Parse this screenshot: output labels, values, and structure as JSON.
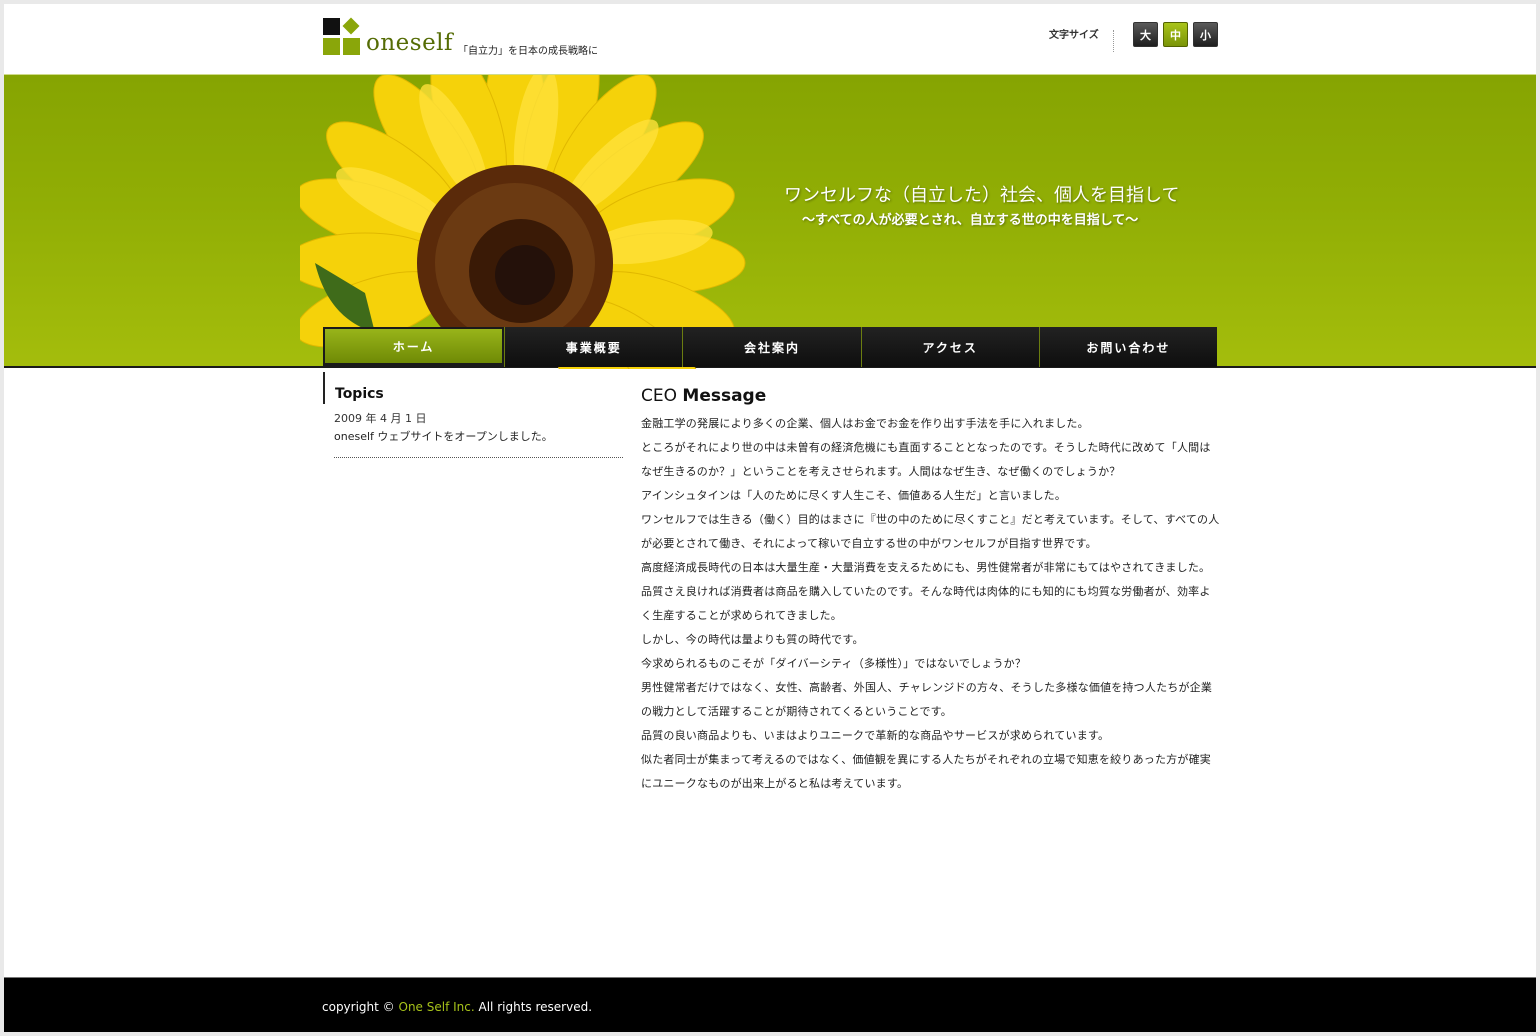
{
  "header": {
    "logo_text": "oneself",
    "tagline": "「自立力」を日本の成長戦略に",
    "fontsize_label": "文字サイズ",
    "fontsize_buttons": [
      {
        "label": "大",
        "active": false
      },
      {
        "label": "中",
        "active": true
      },
      {
        "label": "小",
        "active": false
      }
    ]
  },
  "hero": {
    "title": "ワンセルフな（自立した）社会、個人を目指して",
    "subtitle": "〜すべての人が必要とされ、自立する世の中を目指して〜"
  },
  "nav": {
    "items": [
      {
        "label": "ホーム",
        "active": true
      },
      {
        "label": "事業概要",
        "active": false
      },
      {
        "label": "会社案内",
        "active": false
      },
      {
        "label": "アクセス",
        "active": false
      },
      {
        "label": "お問い合わせ",
        "active": false
      }
    ]
  },
  "topics": {
    "title": "Topics",
    "items": [
      {
        "date": "2009 年 4 月 1 日",
        "text": "oneself ウェブサイトをオープンしました。"
      }
    ]
  },
  "message": {
    "title_a": "CEO",
    "title_b": "Message",
    "paragraphs": [
      "金融工学の発展により多くの企業、個人はお金でお金を作り出す手法を手に入れました。",
      "ところがそれにより世の中は未曽有の経済危機にも直面することとなったのです。そうした時代に改めて「人間はなぜ生きるのか？」ということを考えさせられます。人間はなぜ生き、なぜ働くのでしょうか？",
      "アインシュタインは「人のために尽くす人生こそ、価値ある人生だ」と言いました。",
      "ワンセルフでは生きる（働く）目的はまさに『世の中のために尽くすこと』だと考えています。そして、すべての人が必要とされて働き、それによって稼いで自立する世の中がワンセルフが目指す世界です。",
      "高度経済成長時代の日本は大量生産・大量消費を支えるためにも、男性健常者が非常にもてはやされてきました。",
      "品質さえ良ければ消費者は商品を購入していたのです。そんな時代は肉体的にも知的にも均質な労働者が、効率よく生産することが求められてきました。",
      "しかし、今の時代は量よりも質の時代です。",
      "今求められるものこそが「ダイバーシティ（多様性）」ではないでしょうか？",
      "男性健常者だけではなく、女性、高齢者、外国人、チャレンジドの方々、そうした多様な価値を持つ人たちが企業の戦力として活躍することが期待されてくるということです。",
      "品質の良い商品よりも、いまはよりユニークで革新的な商品やサービスが求められています。",
      "似た者同士が集まって考えるのではなく、価値観を異にする人たちがそれぞれの立場で知恵を絞りあった方が確実にユニークなものが出来上がると私は考えています。"
    ]
  },
  "footer": {
    "copy_prefix": "copyright ©",
    "company": "One Self Inc.",
    "copy_suffix": "All rights reserved."
  },
  "colors": {
    "brand_green": "#8aa60a",
    "hero_green": "#91ae05",
    "nav_dark": "#111111",
    "footer_bg": "#000000"
  },
  "icons": [
    "logo-squares-icon",
    "sunflower-image"
  ]
}
